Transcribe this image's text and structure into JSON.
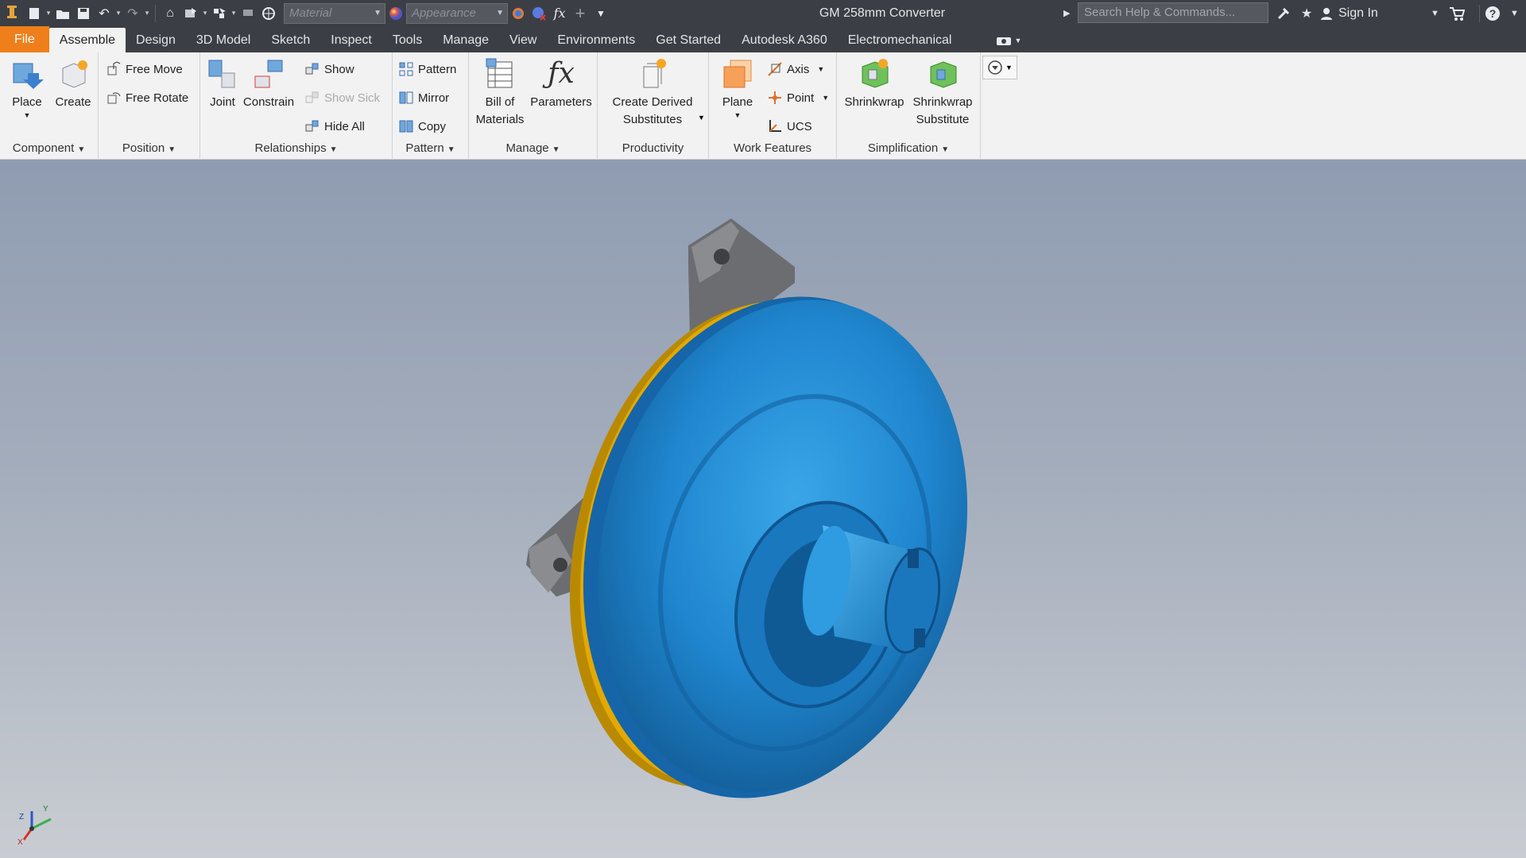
{
  "app": {
    "logo_label": "PRO",
    "document_title": "GM 258mm Converter"
  },
  "quick_access": {
    "material_placeholder": "Material",
    "appearance_placeholder": "Appearance",
    "fx_label": "fx"
  },
  "header_right": {
    "search_placeholder": "Search Help & Commands...",
    "sign_in": "Sign In"
  },
  "tabs": [
    {
      "label": "File"
    },
    {
      "label": "Assemble"
    },
    {
      "label": "Design"
    },
    {
      "label": "3D Model"
    },
    {
      "label": "Sketch"
    },
    {
      "label": "Inspect"
    },
    {
      "label": "Tools"
    },
    {
      "label": "Manage"
    },
    {
      "label": "View"
    },
    {
      "label": "Environments"
    },
    {
      "label": "Get Started"
    },
    {
      "label": "Autodesk A360"
    },
    {
      "label": "Electromechanical"
    }
  ],
  "active_tab": "Assemble",
  "ribbon": {
    "component": {
      "title": "Component",
      "place": "Place",
      "create": "Create"
    },
    "position": {
      "title": "Position",
      "free_move": "Free Move",
      "free_rotate": "Free Rotate"
    },
    "relationships": {
      "title": "Relationships",
      "joint": "Joint",
      "constrain": "Constrain",
      "show": "Show",
      "show_sick": "Show Sick",
      "hide_all": "Hide All"
    },
    "pattern": {
      "title": "Pattern",
      "pattern": "Pattern",
      "mirror": "Mirror",
      "copy": "Copy"
    },
    "manage": {
      "title": "Manage",
      "bom_line1": "Bill of",
      "bom_line2": "Materials",
      "parameters": "Parameters"
    },
    "productivity": {
      "title": "Productivity",
      "derived_line1": "Create Derived",
      "derived_line2": "Substitutes"
    },
    "work_features": {
      "title": "Work Features",
      "plane": "Plane",
      "axis": "Axis",
      "point": "Point",
      "ucs": "UCS"
    },
    "simplification": {
      "title": "Simplification",
      "shrinkwrap": "Shrinkwrap",
      "shrinkwrap_sub_line1": "Shrinkwrap",
      "shrinkwrap_sub_line2": "Substitute"
    }
  },
  "viewcube_axes": {
    "x": "X",
    "y": "Y",
    "z": "Z"
  },
  "colors": {
    "file_tab": "#ef7f1a",
    "model_blue": "#1f86cf",
    "model_yellow": "#e2a900",
    "bracket_gray": "#6b6d70"
  }
}
